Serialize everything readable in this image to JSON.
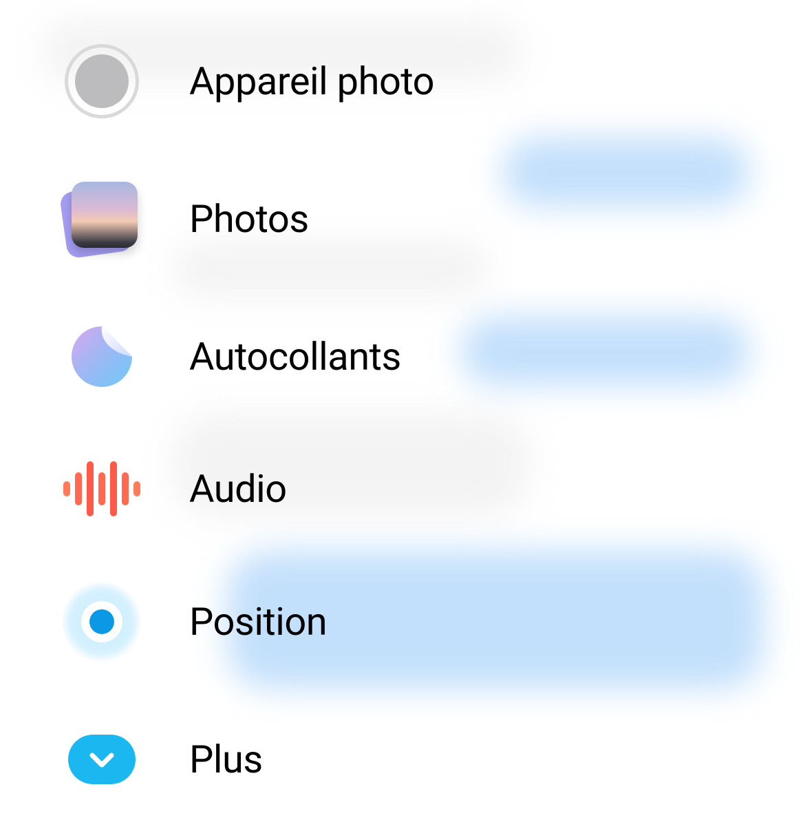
{
  "menu": {
    "items": [
      {
        "label": "Appareil photo"
      },
      {
        "label": "Photos"
      },
      {
        "label": "Autocollants"
      },
      {
        "label": "Audio"
      },
      {
        "label": "Position"
      },
      {
        "label": "Plus"
      }
    ]
  }
}
